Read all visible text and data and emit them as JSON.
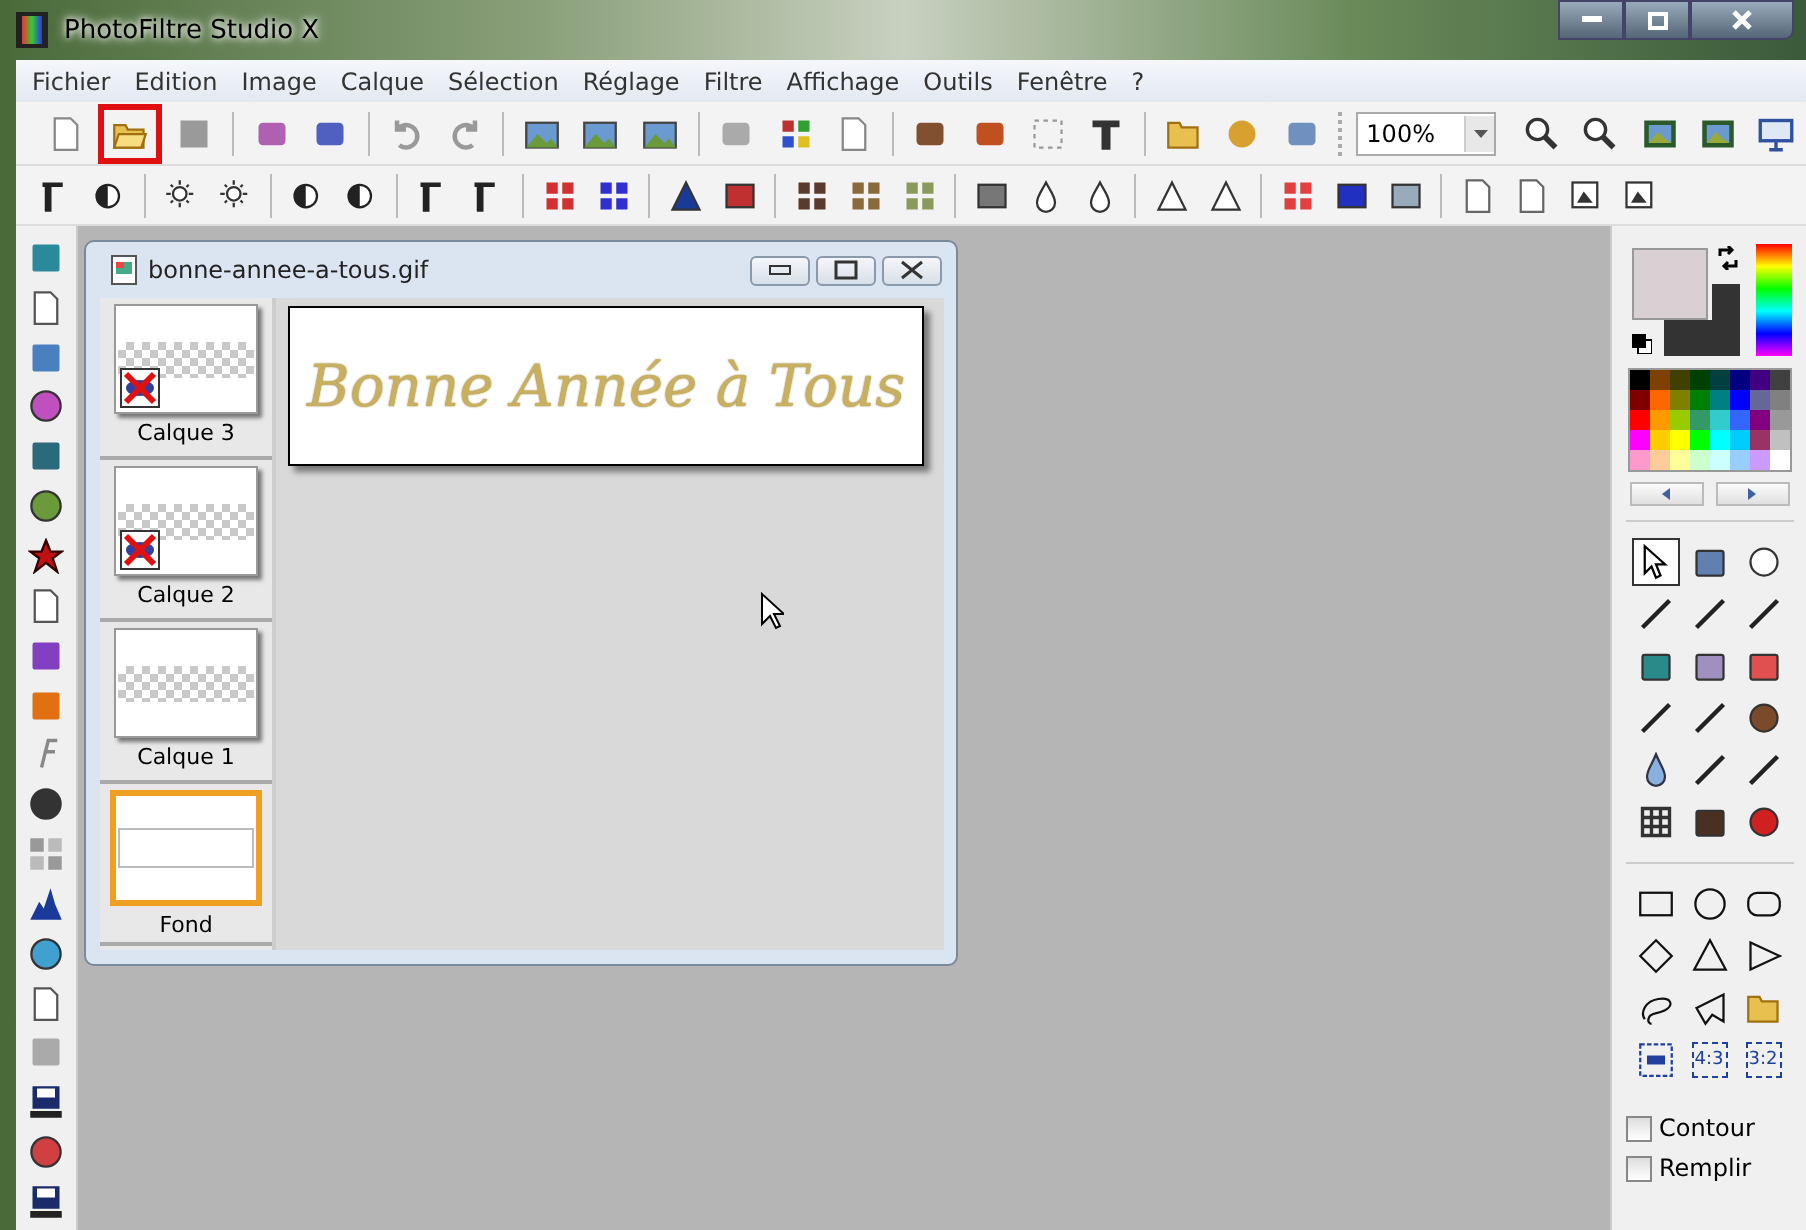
{
  "window": {
    "title": "PhotoFiltre Studio X"
  },
  "menu": [
    "Fichier",
    "Edition",
    "Image",
    "Calque",
    "Sélection",
    "Réglage",
    "Filtre",
    "Affichage",
    "Outils",
    "Fenêtre",
    "?"
  ],
  "open_button": {
    "highlighted": true
  },
  "zoom": {
    "value": "100%"
  },
  "document": {
    "title": "bonne-annee-a-tous.gif",
    "canvas_text": "Bonne Année à Tous",
    "layers": [
      {
        "name": "Calque 3",
        "selected": false,
        "hidden": true
      },
      {
        "name": "Calque 2",
        "selected": false,
        "hidden": true
      },
      {
        "name": "Calque 1",
        "selected": false,
        "hidden": false
      },
      {
        "name": "Fond",
        "selected": true,
        "hidden": false
      }
    ]
  },
  "current_colors": [
    {
      "color": "#d8d0d3"
    },
    {
      "color": "#333333"
    }
  ],
  "swatches": [
    {
      "color": "#000000"
    },
    {
      "color": "#804000"
    },
    {
      "color": "#404000"
    },
    {
      "color": "#004000"
    },
    {
      "color": "#004040"
    },
    {
      "color": "#000080"
    },
    {
      "color": "#400080"
    },
    {
      "color": "#404040"
    },
    {
      "color": "#800000"
    },
    {
      "color": "#ff6600"
    },
    {
      "color": "#808000"
    },
    {
      "color": "#008000"
    },
    {
      "color": "#008080"
    },
    {
      "color": "#0000ff"
    },
    {
      "color": "#666699"
    },
    {
      "color": "#808080"
    },
    {
      "color": "#ff0000"
    },
    {
      "color": "#ff9900"
    },
    {
      "color": "#99cc00"
    },
    {
      "color": "#339966"
    },
    {
      "color": "#33cccc"
    },
    {
      "color": "#3366ff"
    },
    {
      "color": "#800080"
    },
    {
      "color": "#999999"
    },
    {
      "color": "#ff00ff"
    },
    {
      "color": "#ffcc00"
    },
    {
      "color": "#ffff00"
    },
    {
      "color": "#00ff00"
    },
    {
      "color": "#00ffff"
    },
    {
      "color": "#00ccff"
    },
    {
      "color": "#993366"
    },
    {
      "color": "#c0c0c0"
    },
    {
      "color": "#ff99cc"
    },
    {
      "color": "#ffcc99"
    },
    {
      "color": "#ffff99"
    },
    {
      "color": "#ccffcc"
    },
    {
      "color": "#ccffff"
    },
    {
      "color": "#99ccff"
    },
    {
      "color": "#cc99ff"
    },
    {
      "color": "#ffffff"
    }
  ],
  "tools": [
    {
      "selected": true
    },
    {
      "selected": false
    },
    {
      "selected": false
    },
    {
      "selected": false
    },
    {
      "selected": false
    },
    {
      "selected": false
    },
    {
      "selected": false
    },
    {
      "selected": false
    },
    {
      "selected": false
    },
    {
      "selected": false
    },
    {
      "selected": false
    },
    {
      "selected": false
    },
    {
      "selected": false
    },
    {
      "selected": false
    },
    {
      "selected": false
    },
    {
      "selected": false
    },
    {
      "selected": false
    },
    {
      "selected": false
    }
  ],
  "ratio_buttons": [
    "4:3",
    "3:2"
  ],
  "options": [
    {
      "label": "Contour",
      "checked": false
    },
    {
      "label": "Remplir",
      "checked": false
    }
  ]
}
